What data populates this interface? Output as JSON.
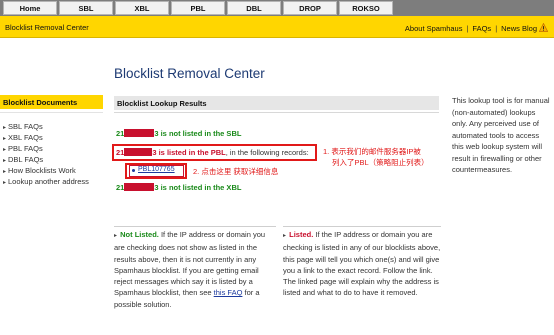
{
  "nav": {
    "tabs": [
      {
        "label": "Home"
      },
      {
        "label": "SBL"
      },
      {
        "label": "XBL"
      },
      {
        "label": "PBL"
      },
      {
        "label": "DBL"
      },
      {
        "label": "DROP"
      },
      {
        "label": "ROKSO"
      }
    ]
  },
  "header": {
    "site_title": "Blocklist Removal Center",
    "links": [
      "About Spamhaus",
      "FAQs",
      "News Blog"
    ],
    "separator": "|"
  },
  "page_title": "Blocklist Removal Center",
  "sidebar": {
    "heading": "Blocklist Documents",
    "items": [
      "SBL FAQs",
      "XBL FAQs",
      "PBL FAQs",
      "DBL FAQs",
      "How Blocklists Work",
      "Lookup another address"
    ]
  },
  "panel": {
    "heading": "Blocklist Lookup Results",
    "ip_prefix": "21",
    "ip_suffix": "3",
    "row_sbl": " is not listed in the SBL",
    "row_pbl_listed": " is listed in the PBL",
    "row_pbl_rest": ", in the following records:",
    "pbl_record": "PBL107765",
    "row_xbl": " is not listed in the XBL"
  },
  "annotations": {
    "note1_line1": "1. 表示我们的邮件服务器IP被",
    "note1_line2": "列入了PBL（策略阻止列表）",
    "note2": "2. 点击这里 获取详细信息"
  },
  "not_listed": {
    "keyword": "Not Listed.",
    "text_before_link": "If the IP address or domain you are checking does not show as listed in the results above, then it is not currently in any Spamhaus blocklist. If you are getting email reject messages which say it is listed by a Spamhaus blocklist, then see",
    "link": "this FAQ",
    "text_after_link": "for a possible solution."
  },
  "listed": {
    "keyword": "Listed.",
    "text": "If the IP address or domain you are checking is listed in any of our blocklists above, this page will tell you which one(s) and will give you a link to the exact record. Follow the link. The linked page will explain why the address is listed and what to do to have it removed."
  },
  "right_info": "This lookup tool is for manual (non-automated) lookups only. Any perceived use of automated tools to access this web lookup system will result in firewalling or other countermeasures.",
  "colors": {
    "nav_bar": "#7d7d7d",
    "brand_yellow": "#ffd600",
    "title_blue": "#1d3a73",
    "status_green": "#1a8a1a",
    "mask_red": "#c8102e",
    "annotation_red": "#e11919"
  },
  "icons": {
    "news_blog": "warning-icon",
    "list_bullet": "triangle-right-icon"
  }
}
